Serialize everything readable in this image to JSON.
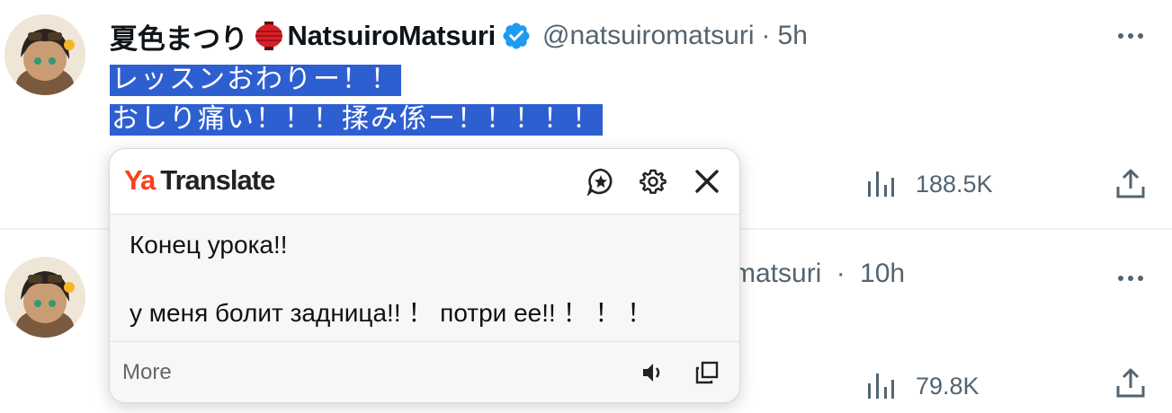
{
  "tweet1": {
    "display_name": "夏色まつり",
    "display_name_latin": "NatsuiroMatsuri",
    "handle": "@natsuiromatsuri",
    "separator": "·",
    "time": "5h",
    "text_line1": "レッスンおわりー！！",
    "text_line2": "おしり痛い！！！揉み係ー！！！！！",
    "views": "188.5K"
  },
  "tweet2": {
    "handle_partial": "matsuri",
    "separator": "·",
    "time": "10h",
    "views": "79.8K"
  },
  "translate_popup": {
    "brand_prefix": "Ya",
    "brand_name": "Translate",
    "translation": "Конец урока!!\n\nу меня болит задница!! ！ потри ее!! ！ ！ ！",
    "more_label": "More",
    "icons": [
      "star-bubble-icon",
      "gear-icon",
      "close-icon",
      "speaker-icon",
      "copy-icon"
    ]
  },
  "colors": {
    "selection": "#2e5fd1",
    "verified": "#1d9bf0",
    "secondary_text": "#536471",
    "brand_ya": "#fc3f1d"
  }
}
